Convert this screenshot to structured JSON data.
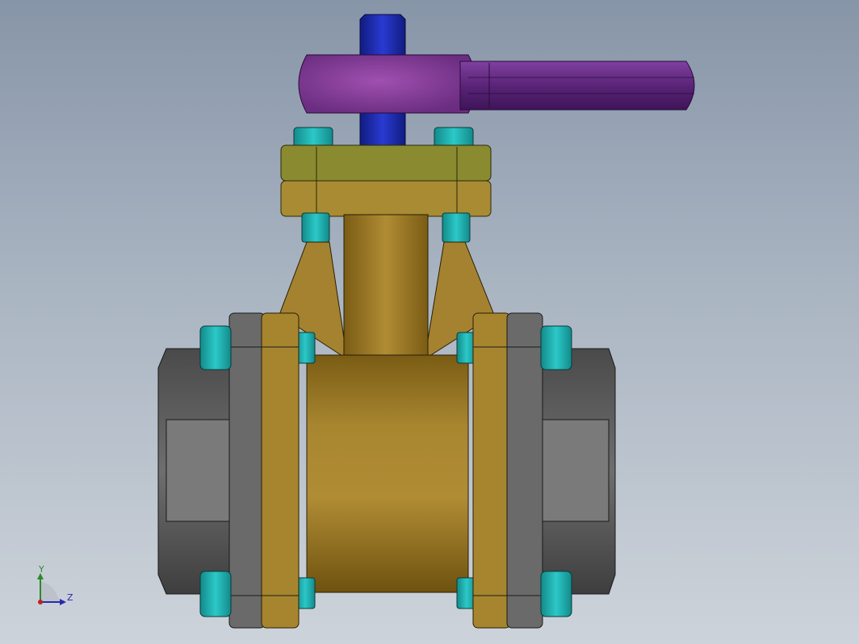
{
  "viewport": {
    "background_top": "#8795a8",
    "background_bottom": "#cdd3da"
  },
  "model": {
    "colors": {
      "stem": "#1e2fb0",
      "handle": "#8a3e9a",
      "handle_dark": "#5c2475",
      "bolt": "#20b0b0",
      "bonnet": "#8a8a30",
      "body": "#a07e2a",
      "body_light": "#b38f35",
      "end_cap": "#5a5a5a",
      "end_cap_light": "#7a7a7a",
      "gasket": "#6a6a6a"
    }
  },
  "triad": {
    "y_label": "Y",
    "z_label": "Z",
    "y_color": "#2a8a2a",
    "z_color": "#2a2ab0",
    "origin_color": "#c02020"
  }
}
